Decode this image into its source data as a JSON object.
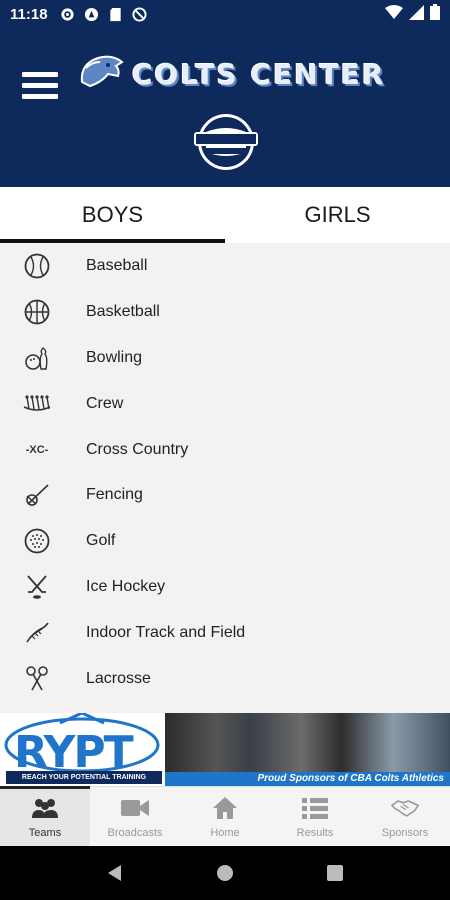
{
  "status_bar": {
    "time": "11:18",
    "icons": [
      "settings-icon",
      "app-icon",
      "sd-card-icon",
      "no-sim-icon"
    ],
    "right_icons": [
      "wifi-icon",
      "signal-icon",
      "battery-icon"
    ]
  },
  "header": {
    "title": "COLTS CENTER",
    "sponsor": "WORLD SUBARU",
    "colors": {
      "background": "#0e2a5c",
      "title": "#e8eef8"
    }
  },
  "tabs": [
    {
      "label": "BOYS",
      "active": true
    },
    {
      "label": "GIRLS",
      "active": false
    }
  ],
  "sports": [
    {
      "label": "Baseball",
      "icon": "baseball-icon"
    },
    {
      "label": "Basketball",
      "icon": "basketball-icon"
    },
    {
      "label": "Bowling",
      "icon": "bowling-icon"
    },
    {
      "label": "Crew",
      "icon": "crew-icon"
    },
    {
      "label": "Cross Country",
      "icon": "cross-country-icon"
    },
    {
      "label": "Fencing",
      "icon": "fencing-icon"
    },
    {
      "label": "Golf",
      "icon": "golf-icon"
    },
    {
      "label": "Ice Hockey",
      "icon": "ice-hockey-icon"
    },
    {
      "label": "Indoor Track and Field",
      "icon": "track-icon"
    },
    {
      "label": "Lacrosse",
      "icon": "lacrosse-icon"
    }
  ],
  "ad": {
    "brand": "RYPT",
    "tagline": "REACH YOUR POTENTIAL TRAINING",
    "strip": "Proud Sponsors of CBA Colts Athletics"
  },
  "bottom_nav": [
    {
      "label": "Teams",
      "icon": "teams-icon",
      "active": true
    },
    {
      "label": "Broadcasts",
      "icon": "video-icon",
      "active": false
    },
    {
      "label": "Home",
      "icon": "home-icon",
      "active": false
    },
    {
      "label": "Results",
      "icon": "results-icon",
      "active": false
    },
    {
      "label": "Sponsors",
      "icon": "handshake-icon",
      "active": false
    }
  ],
  "sports_icon_text": {
    "cross_country": "XC"
  }
}
